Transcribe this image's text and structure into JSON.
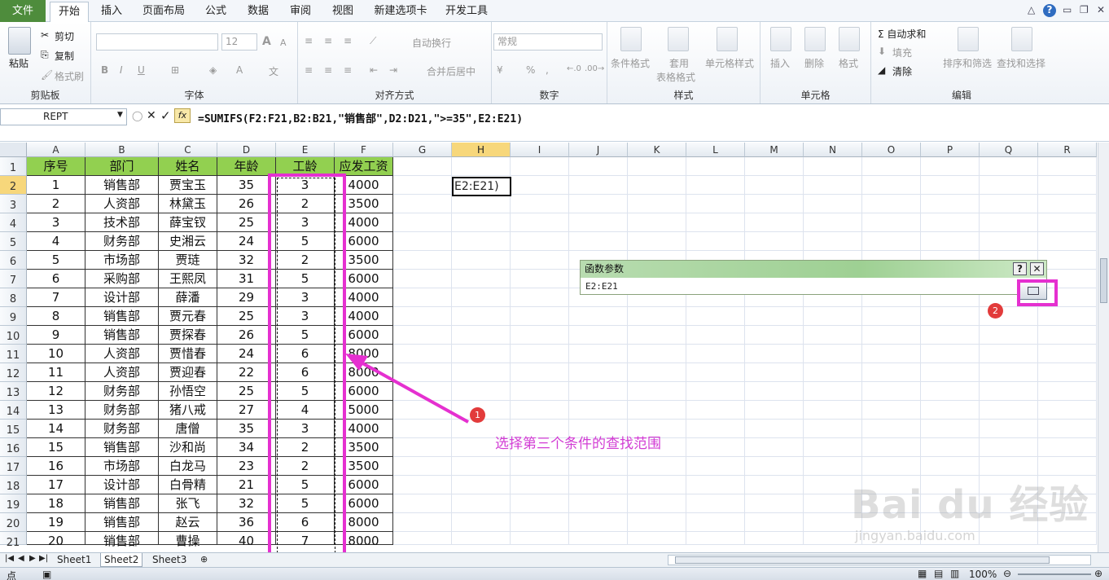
{
  "ribbon_tabs": [
    "文件",
    "开始",
    "插入",
    "页面布局",
    "公式",
    "数据",
    "审阅",
    "视图",
    "新建选项卡",
    "开发工具"
  ],
  "clipboard": {
    "paste": "粘贴",
    "cut": "剪切",
    "copy": "复制",
    "format_painter": "格式刷",
    "label": "剪贴板"
  },
  "font": {
    "name": "",
    "size": "12",
    "label": "字体",
    "bold": "B",
    "italic": "I",
    "underline": "U",
    "grow": "A",
    "shrink": "A"
  },
  "alignment": {
    "wrap": "自动换行",
    "merge": "合并后居中",
    "label": "对齐方式"
  },
  "number": {
    "format": "常规",
    "percent": "%",
    "label": "数字"
  },
  "styles": {
    "conditional": "条件格式",
    "table_a": "套用",
    "table_b": "表格格式",
    "cell_styles": "单元格样式",
    "label": "样式"
  },
  "cells": {
    "insert": "插入",
    "delete": "删除",
    "format": "格式",
    "label": "单元格"
  },
  "editing": {
    "autosum": "Σ 自动求和",
    "fill": "填充",
    "clear": "清除",
    "sort": "排序和筛选",
    "find": "查找和选择",
    "label": "编辑"
  },
  "formula_bar": {
    "name": "REPT",
    "fx": "fx",
    "formula": "=SUMIFS(F2:F21,B2:B21,\"销售部\",D2:D21,\">=35\",E2:E21)"
  },
  "columns": [
    "A",
    "B",
    "C",
    "D",
    "E",
    "F",
    "G",
    "H",
    "I",
    "J",
    "K",
    "L",
    "M",
    "N",
    "O",
    "P",
    "Q",
    "R"
  ],
  "table_header": [
    "序号",
    "部门",
    "姓名",
    "年龄",
    "工龄",
    "应发工资"
  ],
  "rows": [
    [
      "1",
      "销售部",
      "贾宝玉",
      "35",
      "3",
      "4000"
    ],
    [
      "2",
      "人资部",
      "林黛玉",
      "26",
      "2",
      "3500"
    ],
    [
      "3",
      "技术部",
      "薛宝钗",
      "25",
      "3",
      "4000"
    ],
    [
      "4",
      "财务部",
      "史湘云",
      "24",
      "5",
      "6000"
    ],
    [
      "5",
      "市场部",
      "贾琏",
      "32",
      "2",
      "3500"
    ],
    [
      "6",
      "采购部",
      "王熙凤",
      "31",
      "5",
      "6000"
    ],
    [
      "7",
      "设计部",
      "薛潘",
      "29",
      "3",
      "4000"
    ],
    [
      "8",
      "销售部",
      "贾元春",
      "25",
      "3",
      "4000"
    ],
    [
      "9",
      "销售部",
      "贾探春",
      "26",
      "5",
      "6000"
    ],
    [
      "10",
      "人资部",
      "贾惜春",
      "24",
      "6",
      "8000"
    ],
    [
      "11",
      "人资部",
      "贾迎春",
      "22",
      "6",
      "8000"
    ],
    [
      "12",
      "财务部",
      "孙悟空",
      "25",
      "5",
      "6000"
    ],
    [
      "13",
      "财务部",
      "猪八戒",
      "27",
      "4",
      "5000"
    ],
    [
      "14",
      "财务部",
      "唐僧",
      "35",
      "3",
      "4000"
    ],
    [
      "15",
      "销售部",
      "沙和尚",
      "34",
      "2",
      "3500"
    ],
    [
      "16",
      "市场部",
      "白龙马",
      "23",
      "2",
      "3500"
    ],
    [
      "17",
      "设计部",
      "白骨精",
      "21",
      "5",
      "6000"
    ],
    [
      "18",
      "销售部",
      "张飞",
      "32",
      "5",
      "6000"
    ],
    [
      "19",
      "销售部",
      "赵云",
      "36",
      "6",
      "8000"
    ],
    [
      "20",
      "销售部",
      "曹操",
      "40",
      "7",
      "8000"
    ]
  ],
  "row_numbers": [
    "1",
    "2",
    "3",
    "4",
    "5",
    "6",
    "7",
    "8",
    "9",
    "10",
    "11",
    "12",
    "13",
    "14",
    "15",
    "16",
    "17",
    "18",
    "19",
    "20",
    "21"
  ],
  "active_cell_text": "E2:E21)",
  "dialog": {
    "title": "函数参数",
    "help": "?",
    "close": "✕",
    "input": "E2:E21"
  },
  "annotations": {
    "badge1": "1",
    "badge2": "2",
    "note": "选择第三个条件的查找范围"
  },
  "sheets": [
    "Sheet1",
    "Sheet2",
    "Sheet3"
  ],
  "status": {
    "mode": "点",
    "zoom": "100%"
  },
  "watermark": {
    "brand": "Bai  du 经验",
    "url": "jingyan.baidu.com"
  },
  "colors": {
    "header_green": "#92d050",
    "highlight": "#e530d0",
    "file_tab": "#4e8c3c"
  }
}
